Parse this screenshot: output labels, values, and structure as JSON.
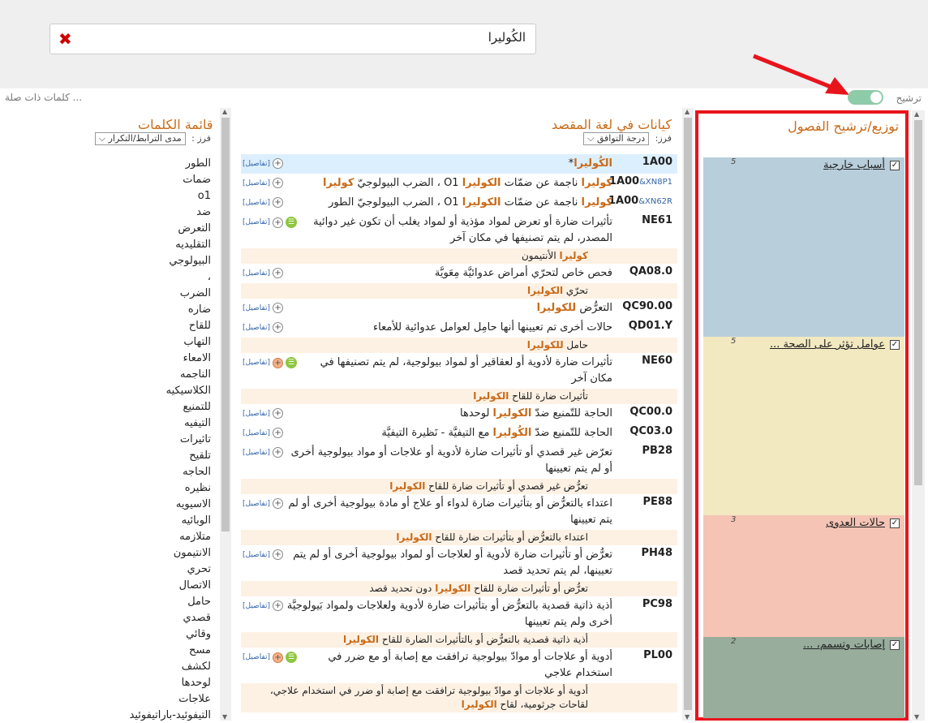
{
  "search": {
    "value": "الكُوليرا"
  },
  "filter": {
    "related_label": "كلمات ذات صلة ...",
    "tarsheeh_label": "ترشيح",
    "toggle_on": true
  },
  "colors": {
    "accent": "#c96a17",
    "highlight_border": "#e8141c",
    "toggle": "#8ecba9"
  },
  "chapters": {
    "title": "توزيع/ترشيح الفصول",
    "items": [
      {
        "label": "أسباب خارجية",
        "count": "5",
        "color": "#b8cfdb"
      },
      {
        "label": "عوامل تؤثر على الصحة ...",
        "count": "5",
        "color": "#f2e9c0"
      },
      {
        "label": "حالات العدوى",
        "count": "3",
        "color": "#f5c4b4"
      },
      {
        "label": "إصابات وتسمم، ...",
        "count": "2",
        "color": "#98ad9c"
      }
    ]
  },
  "entities": {
    "title": "كيانات في لغة المقصد",
    "sort_label": "فرز:",
    "sort_value": "درجة التوافق",
    "details_label": "[تفاصيل]",
    "items": [
      {
        "code": "1A00",
        "x": "",
        "title_html": "<span class='hl'>الكُوليرا</span>*",
        "sub": ""
      },
      {
        "code": "1A00",
        "x": "&XN8P1",
        "title_html": "<span class='hl'>كوليرا</span> ناجمة عن ضمّات <span class='hl'>الكوليرا</span> O1 ، الضرب البيولوجيّ <span class='hl'>كوليرا</span>",
        "sub": ""
      },
      {
        "code": "1A00",
        "x": "&XN62R",
        "title_html": "<span class='hl'>كوليرا</span> ناجمة عن ضمّات <span class='hl'>الكوليرا</span> O1 ، الضرب البيولوجيّ الطور",
        "sub": ""
      },
      {
        "code": "NE61",
        "x": "",
        "title_html": "تأثيرات ضارة أو تعرض لمواد مؤذية أو لمواد يغلب أن تكون غير دوائية المصدر، لم يتم تصنيفها في مكان آخر",
        "sub": "<span class='hl'>كوليرا</span> الأنتيمون"
      },
      {
        "code": "QA08.0",
        "x": "",
        "title_html": "فحص خاص لتحرّي أمراض عدوائيَّة مِعَويَّة",
        "sub": "تحرّي <span class='hl'>الكوليرا</span>"
      },
      {
        "code": "QC90.00",
        "x": "",
        "title_html": "التعرُّض <span class='hl'>للكوليرا</span>",
        "sub": ""
      },
      {
        "code": "QD01.Y",
        "x": "",
        "title_html": "حالات أخرى تم تعيينها أنها حامِل لعوامل عدوائية للأمعاء",
        "sub": "حامل <span class='hl'>للكوليرا</span>"
      },
      {
        "code": "NE60",
        "x": "",
        "title_html": "تأثيرات ضارة لأدوية أو لعقاقير أو لمواد بيولوجية، لم يتم تصنيفها في مكان آخر",
        "sub": "تأثيرات ضارة للقاح <span class='hl'>الكوليرا</span>"
      },
      {
        "code": "QC00.0",
        "x": "",
        "title_html": "الحاجة للتّمنيع ضدّ <span class='hl'>الكوليرا</span> لوحدها",
        "sub": ""
      },
      {
        "code": "QC03.0",
        "x": "",
        "title_html": "الحاجة للتّمنيع ضدّ <span class='hl'>الكُوليرا</span> مع التيفيَّة - نَظيرة التيفيَّة",
        "sub": ""
      },
      {
        "code": "PB28",
        "x": "",
        "title_html": "تعرّض غير قصدي أو تأثيرات ضارة لأدوية أو علاجات أو مواد بيولوجية أخرى أو لم يتم تعيينها",
        "sub": "تعرُّض غير قصدي أو تأثيرات ضارة للقاح <span class='hl'>الكوليرا</span>"
      },
      {
        "code": "PE88",
        "x": "",
        "title_html": "اعتداء بالتعرُّض أو بتأثيرات ضارة لدواء أو علاج أو مادة بيولوجية أخرى أو لم يتم تعيينها",
        "sub": "اعتداء بالتعرُّض أو بتأثيرات ضارة للقاح <span class='hl'>الكوليرا</span>"
      },
      {
        "code": "PH48",
        "x": "",
        "title_html": "تعرُّض أو تأثيرات ضارة لأدوية أو لعلاجات أو لمواد بيولوجية أخرى أو لم يتم تعيينها، لم يتم تحديد قصد",
        "sub": "تعرُّض أو تأثيرات ضارة للقاح <span class='hl'>الكوليرا</span> دون تحديد قصد"
      },
      {
        "code": "PC98",
        "x": "",
        "title_html": "أذية ذاتية قصدية بالتعرُّض أو بتأثيرات ضارة لأدوية ولعلاجات ولمواد بَيولوجيَّة أخرى ولم يتم تعيينها",
        "sub": "أذية ذاتية قصدية بالتعرُّض أو بالتأثيرات الضارة للقاح <span class='hl'>الكوليرا</span>"
      },
      {
        "code": "PL00",
        "x": "",
        "title_html": "أدوية أو علاجات أو موادّ بيولوجية ترافقت مع إصابة أو مع ضرر في استخدام علاجي",
        "sub": "أدوية أو علاجات أو موادّ بيولوجية ترافقت مع إصابة أو ضرر في استخدام علاجي، لقاحات جرثومية، لقاح <span class='hl'>الكوليرا</span>"
      }
    ]
  },
  "words": {
    "title": "قائمة الكلمات",
    "sort_label": "فرز :",
    "sort_value": "مدى الترابط/التكرار",
    "items": [
      "الطور",
      "ضمات",
      "o1",
      "ضد",
      "التعرض",
      "التقليديه",
      "البيولوجي",
      "،",
      "الضرب",
      "ضاره",
      "للقاح",
      "التهاب",
      "الامعاء",
      "الناجمه",
      "الكلاسيكيه",
      "للتمنيع",
      "التيفيه",
      "تاثيرات",
      "تلقيح",
      "الحاجه",
      "نظيره",
      "الاسيويه",
      "الوبائيه",
      "متلازمه",
      "الانتيمون",
      "تحري",
      "الاتصال",
      "حامل",
      "قصدي",
      "وقائي",
      "مسح",
      "لكشف",
      "لوحدها",
      "علاجات",
      "التيفوئيد-باراتيفوئيد"
    ]
  }
}
